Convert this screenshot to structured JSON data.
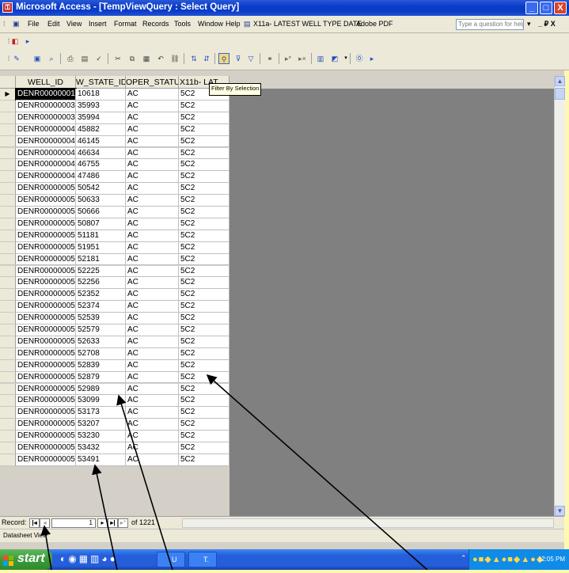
{
  "window": {
    "title": "Microsoft Access - [TempViewQuery : Select Query]",
    "controls": [
      "_",
      "□",
      "X"
    ]
  },
  "menu": {
    "items": [
      "File",
      "Edit",
      "View",
      "Insert",
      "Format",
      "Records",
      "Tools",
      "Window",
      "Help"
    ],
    "query_label": "X11a- LATEST WELL TYPE DATE",
    "adobe_label": "Adobe PDF",
    "help_placeholder": "Type a question for help",
    "doc_controls": "_ ₽ X"
  },
  "toolbar": {
    "tooltip": "Filter By Selection",
    "icons": [
      "view-icon",
      "save-icon",
      "search-icon",
      "print-icon",
      "print-preview-icon",
      "spelling-icon",
      "cut-icon",
      "copy-icon",
      "paste-icon",
      "undo-icon",
      "insert-hyperlink-icon",
      "sort-ascending-icon",
      "sort-descending-icon",
      "filter-by-selection-icon",
      "filter-by-form-icon",
      "apply-filter-icon",
      "find-icon",
      "new-record-icon",
      "delete-record-icon",
      "database-window-icon",
      "new-object-icon",
      "help-icon"
    ]
  },
  "datasheet": {
    "columns": [
      "WELL_ID",
      "W_STATE_ID",
      "OPER_STATUS",
      "X11b- LAT"
    ],
    "rows": [
      [
        "DENR00000001",
        "10618",
        "AC",
        "5C2"
      ],
      [
        "DENR00000003",
        "35993",
        "AC",
        "5C2"
      ],
      [
        "DENR00000003",
        "35994",
        "AC",
        "5C2"
      ],
      [
        "DENR00000004",
        "45882",
        "AC",
        "5C2"
      ],
      [
        "DENR00000004",
        "46145",
        "AC",
        "5C2"
      ],
      [
        "DENR00000004",
        "46634",
        "AC",
        "5C2"
      ],
      [
        "DENR00000004",
        "46755",
        "AC",
        "5C2"
      ],
      [
        "DENR00000004",
        "47486",
        "AC",
        "5C2"
      ],
      [
        "DENR00000005",
        "50542",
        "AC",
        "5C2"
      ],
      [
        "DENR00000005",
        "50633",
        "AC",
        "5C2"
      ],
      [
        "DENR00000005",
        "50666",
        "AC",
        "5C2"
      ],
      [
        "DENR00000005",
        "50807",
        "AC",
        "5C2"
      ],
      [
        "DENR00000005",
        "51181",
        "AC",
        "5C2"
      ],
      [
        "DENR00000005",
        "51951",
        "AC",
        "5C2"
      ],
      [
        "DENR00000005",
        "52181",
        "AC",
        "5C2"
      ],
      [
        "DENR00000005",
        "52225",
        "AC",
        "5C2"
      ],
      [
        "DENR00000005",
        "52256",
        "AC",
        "5C2"
      ],
      [
        "DENR00000005",
        "52352",
        "AC",
        "5C2"
      ],
      [
        "DENR00000005",
        "52374",
        "AC",
        "5C2"
      ],
      [
        "DENR00000005",
        "52539",
        "AC",
        "5C2"
      ],
      [
        "DENR00000005",
        "52579",
        "AC",
        "5C2"
      ],
      [
        "DENR00000005",
        "52633",
        "AC",
        "5C2"
      ],
      [
        "DENR00000005",
        "52708",
        "AC",
        "5C2"
      ],
      [
        "DENR00000005",
        "52839",
        "AC",
        "5C2"
      ],
      [
        "DENR00000005",
        "52879",
        "AC",
        "5C2"
      ],
      [
        "DENR00000005",
        "52989",
        "AC",
        "5C2"
      ],
      [
        "DENR00000005",
        "53099",
        "AC",
        "5C2"
      ],
      [
        "DENR00000005",
        "53173",
        "AC",
        "5C2"
      ],
      [
        "DENR00000005",
        "53207",
        "AC",
        "5C2"
      ],
      [
        "DENR00000005",
        "53230",
        "AC",
        "5C2"
      ],
      [
        "DENR00000005",
        "53432",
        "AC",
        "5C2"
      ],
      [
        "DENR00000005",
        "53491",
        "AC",
        "5C2"
      ]
    ]
  },
  "navigation": {
    "record_label": "Record:",
    "current_record": "1",
    "of_label": "of 1221"
  },
  "status": {
    "text": "Datasheet View"
  },
  "taskbar": {
    "start_label": "start",
    "tasks": [
      "U",
      "T."
    ],
    "clock": "12:05 PM"
  },
  "colors": {
    "titlebar": "#0a3cc8",
    "chrome": "#ece9d8",
    "taskbar": "#245edb",
    "background": "#fff9b0",
    "empty_area": "#808080"
  }
}
